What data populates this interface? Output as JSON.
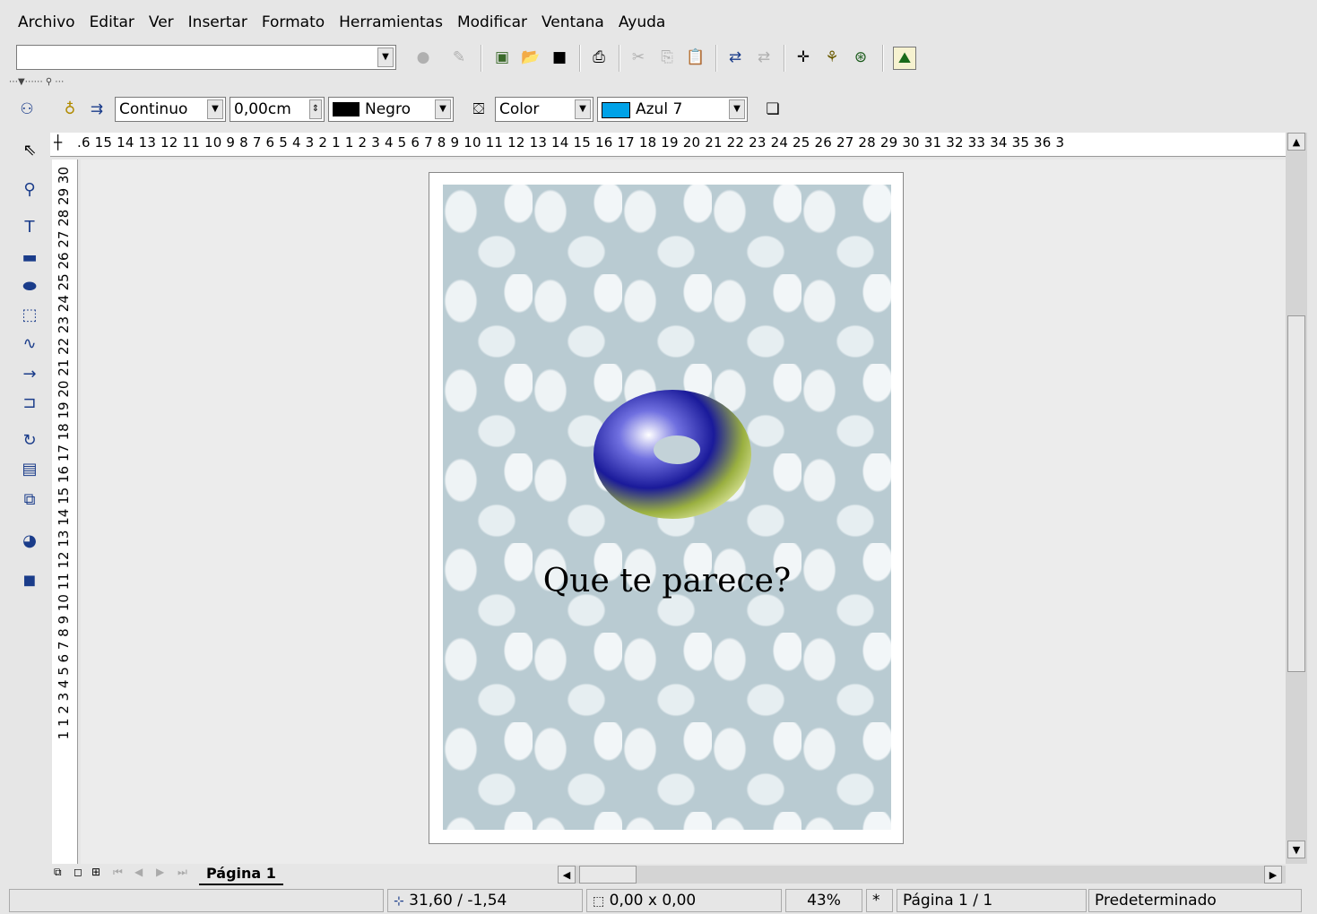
{
  "menu": [
    "Archivo",
    "Editar",
    "Ver",
    "Insertar",
    "Formato",
    "Herramientas",
    "Modificar",
    "Ventana",
    "Ayuda"
  ],
  "toolbar2": {
    "line_style": "Continuo",
    "line_width": "0,00cm",
    "line_color": "Negro",
    "line_color_hex": "#000000",
    "area_style": "Color",
    "area_color": "Azul 7",
    "area_color_hex": "#00a2e8"
  },
  "rulers": {
    "horizontal": ".6 15 14 13 12 11 10 9 8 7 6 5 4 3 2 1  1 2 3 4 5 6 7 8 9 10 11 12 13 14 15 16 17 18 19 20 21 22 23 24 25 26 27 28 29 30 31 32 33 34 35 36 3",
    "vertical": "1 1 2 3 4 5 6 7 8 9 10 11 12 13 14 15 16 17 18 19 20 21 22 23 24 25 26 27 28 29 30"
  },
  "document": {
    "text": "Que te parece?"
  },
  "tabs": [
    "Página 1"
  ],
  "status": {
    "position": "31,60 / -1,54",
    "size": "0,00 x 0,00",
    "zoom": "43%",
    "modified": "*",
    "page": "Página 1 / 1",
    "style": "Predeterminado"
  }
}
